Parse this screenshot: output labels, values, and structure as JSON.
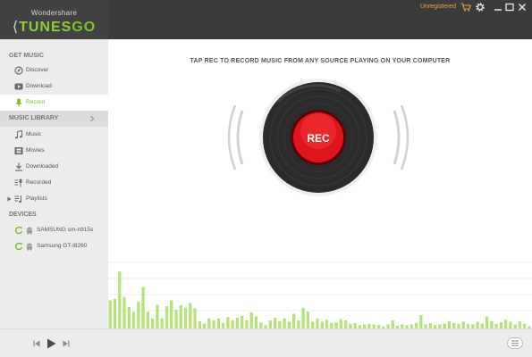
{
  "app": {
    "brand_small": "Wondershare",
    "brand_name_prefix": "TUNES",
    "brand_name_suffix": "GO",
    "brand_color": "#7cb928"
  },
  "topbar": {
    "unregistered_label": "Unregistered",
    "unregistered_color": "#f0a23c",
    "icons": [
      "cart-icon",
      "settings-icon",
      "minimize-icon",
      "maximize-icon",
      "close-icon"
    ]
  },
  "sidebar": {
    "get_music": {
      "header": "GET MUSIC",
      "items": [
        {
          "label": "Discover",
          "icon": "compass-icon",
          "active": false
        },
        {
          "label": "Download",
          "icon": "download-icon",
          "active": false
        },
        {
          "label": "Record",
          "icon": "microphone-icon",
          "active": true
        }
      ]
    },
    "library": {
      "header": "MUSIC LIBRARY",
      "items": [
        {
          "label": "Music",
          "icon": "music-note-icon"
        },
        {
          "label": "Movies",
          "icon": "film-icon"
        },
        {
          "label": "Downloaded",
          "icon": "download-arrow-icon"
        },
        {
          "label": "Recorded",
          "icon": "microphone-list-icon"
        },
        {
          "label": "Playlists",
          "icon": "playlist-icon"
        }
      ]
    },
    "devices": {
      "header": "DEVICES",
      "items": [
        {
          "label": "SAMSUNG sm-n915s",
          "icon": "android-icon"
        },
        {
          "label": "Samsung GT-I8260",
          "icon": "android-icon"
        }
      ]
    }
  },
  "main": {
    "headline": "TAP REC TO RECORD MUSIC FROM ANY SOURCE PLAYING ON YOUR COMPUTER",
    "rec_button_label": "REC",
    "rec_button_color": "#e0141b",
    "waveform_color": "#b7e27a",
    "waveform_levels": [
      0.42,
      0.44,
      0.85,
      0.47,
      0.32,
      0.25,
      0.4,
      0.62,
      0.25,
      0.15,
      0.35,
      0.15,
      0.33,
      0.42,
      0.28,
      0.35,
      0.31,
      0.38,
      0.3,
      0.11,
      0.07,
      0.15,
      0.12,
      0.15,
      0.08,
      0.17,
      0.12,
      0.16,
      0.19,
      0.12,
      0.24,
      0.18,
      0.09,
      0.05,
      0.12,
      0.16,
      0.11,
      0.15,
      0.1,
      0.22,
      0.12,
      0.31,
      0.25,
      0.1,
      0.15,
      0.1,
      0.13,
      0.08,
      0.09,
      0.14,
      0.12,
      0.07,
      0.08,
      0.05,
      0.06,
      0.07,
      0.06,
      0.05,
      0.03,
      0.06,
      0.12,
      0.04,
      0.06,
      0.05,
      0.06,
      0.08,
      0.2,
      0.06,
      0.08,
      0.05,
      0.06,
      0.07,
      0.11,
      0.08,
      0.07,
      0.1,
      0.07,
      0.06,
      0.1,
      0.07,
      0.18,
      0.11,
      0.07,
      0.09,
      0.13,
      0.1,
      0.06,
      0.11,
      0.07,
      0.03
    ]
  },
  "player": {
    "controls": [
      "previous-icon",
      "play-icon",
      "next-icon",
      "playlist-toggle-icon"
    ]
  }
}
